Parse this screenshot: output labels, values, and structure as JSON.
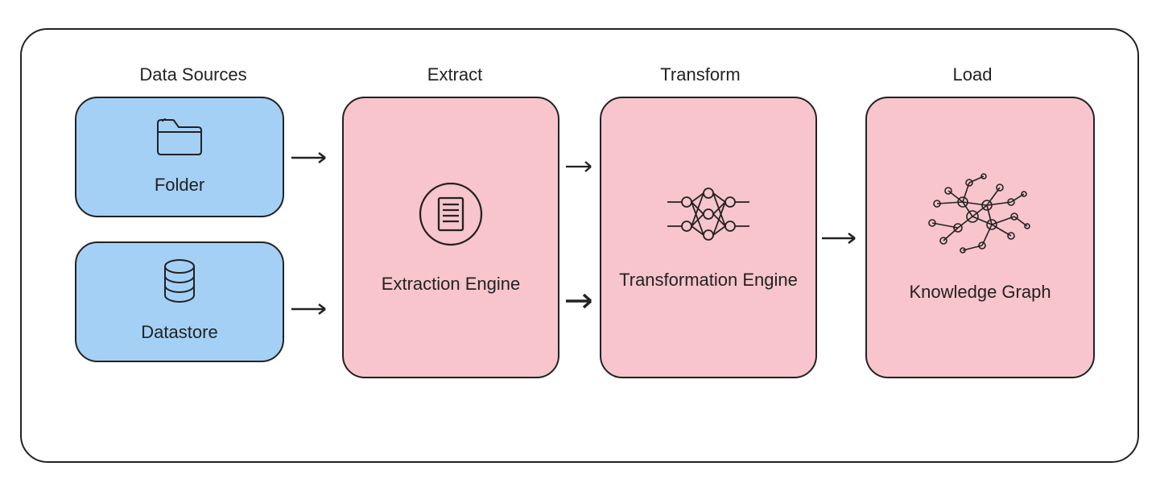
{
  "sections": {
    "data_sources": "Data Sources",
    "extract": "Extract",
    "transform": "Transform",
    "load": "Load"
  },
  "nodes": {
    "folder": {
      "label": "Folder",
      "icon": "folder",
      "color": "#a4d0f5"
    },
    "datastore": {
      "label": "Datastore",
      "icon": "database",
      "color": "#a4d0f5"
    },
    "extraction_engine": {
      "label": "Extraction Engine",
      "icon": "document-circle",
      "color": "#f7c5cb"
    },
    "transformation_engine": {
      "label": "Transformation Engine",
      "icon": "neural-net",
      "color": "#f7c5cb"
    },
    "knowledge_graph": {
      "label": "Knowledge Graph",
      "icon": "graph",
      "color": "#f7c5cb"
    }
  },
  "edges": [
    {
      "from": "folder",
      "to": "extraction_engine"
    },
    {
      "from": "datastore",
      "to": "extraction_engine"
    },
    {
      "from": "extraction_engine",
      "to": "transformation_engine"
    },
    {
      "from": "extraction_engine",
      "to": "transformation_engine"
    },
    {
      "from": "transformation_engine",
      "to": "knowledge_graph"
    }
  ]
}
